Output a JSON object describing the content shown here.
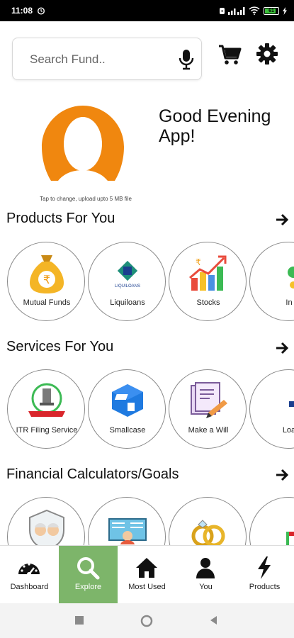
{
  "status_bar": {
    "time": "11:08",
    "battery": "61"
  },
  "search": {
    "placeholder": "Search Fund.."
  },
  "profile": {
    "upload_hint": "Tap to change, upload upto 5 MB file",
    "greeting_line1": "Good Evening",
    "greeting_line2": "App!"
  },
  "sections": {
    "products": {
      "title": "Products For You",
      "items": [
        {
          "label": "Mutual Funds",
          "icon": "money-bag-icon"
        },
        {
          "label": "Liquiloans",
          "icon": "liquiloans-logo"
        },
        {
          "label": "Stocks",
          "icon": "stocks-chart-icon"
        },
        {
          "label": "In",
          "icon": "partial-icon"
        }
      ]
    },
    "services": {
      "title": "Services For You",
      "items": [
        {
          "label": "ITR Filing Service",
          "icon": "itr-emblem-icon"
        },
        {
          "label": "Smallcase",
          "icon": "smallcase-logo"
        },
        {
          "label": "Make a Will",
          "icon": "will-document-icon"
        },
        {
          "label": "Loa",
          "icon": "partial-icon"
        }
      ]
    },
    "calculators": {
      "title": "Financial Calculators/Goals",
      "items": [
        {
          "label": "",
          "icon": "retirement-icon"
        },
        {
          "label": "",
          "icon": "education-icon"
        },
        {
          "label": "",
          "icon": "marriage-rings-icon"
        },
        {
          "label": "",
          "icon": "partial-icon"
        }
      ]
    }
  },
  "bottom_nav": [
    {
      "label": "Dashboard",
      "icon": "dashboard-gauge-icon",
      "active": false
    },
    {
      "label": "Explore",
      "icon": "search-icon",
      "active": true
    },
    {
      "label": "Most Used",
      "icon": "home-icon",
      "active": false
    },
    {
      "label": "You",
      "icon": "user-icon",
      "active": false
    },
    {
      "label": "Products",
      "icon": "lightning-icon",
      "active": false
    }
  ],
  "colors": {
    "accent": "#7db56a",
    "avatar": "#f0870f"
  }
}
